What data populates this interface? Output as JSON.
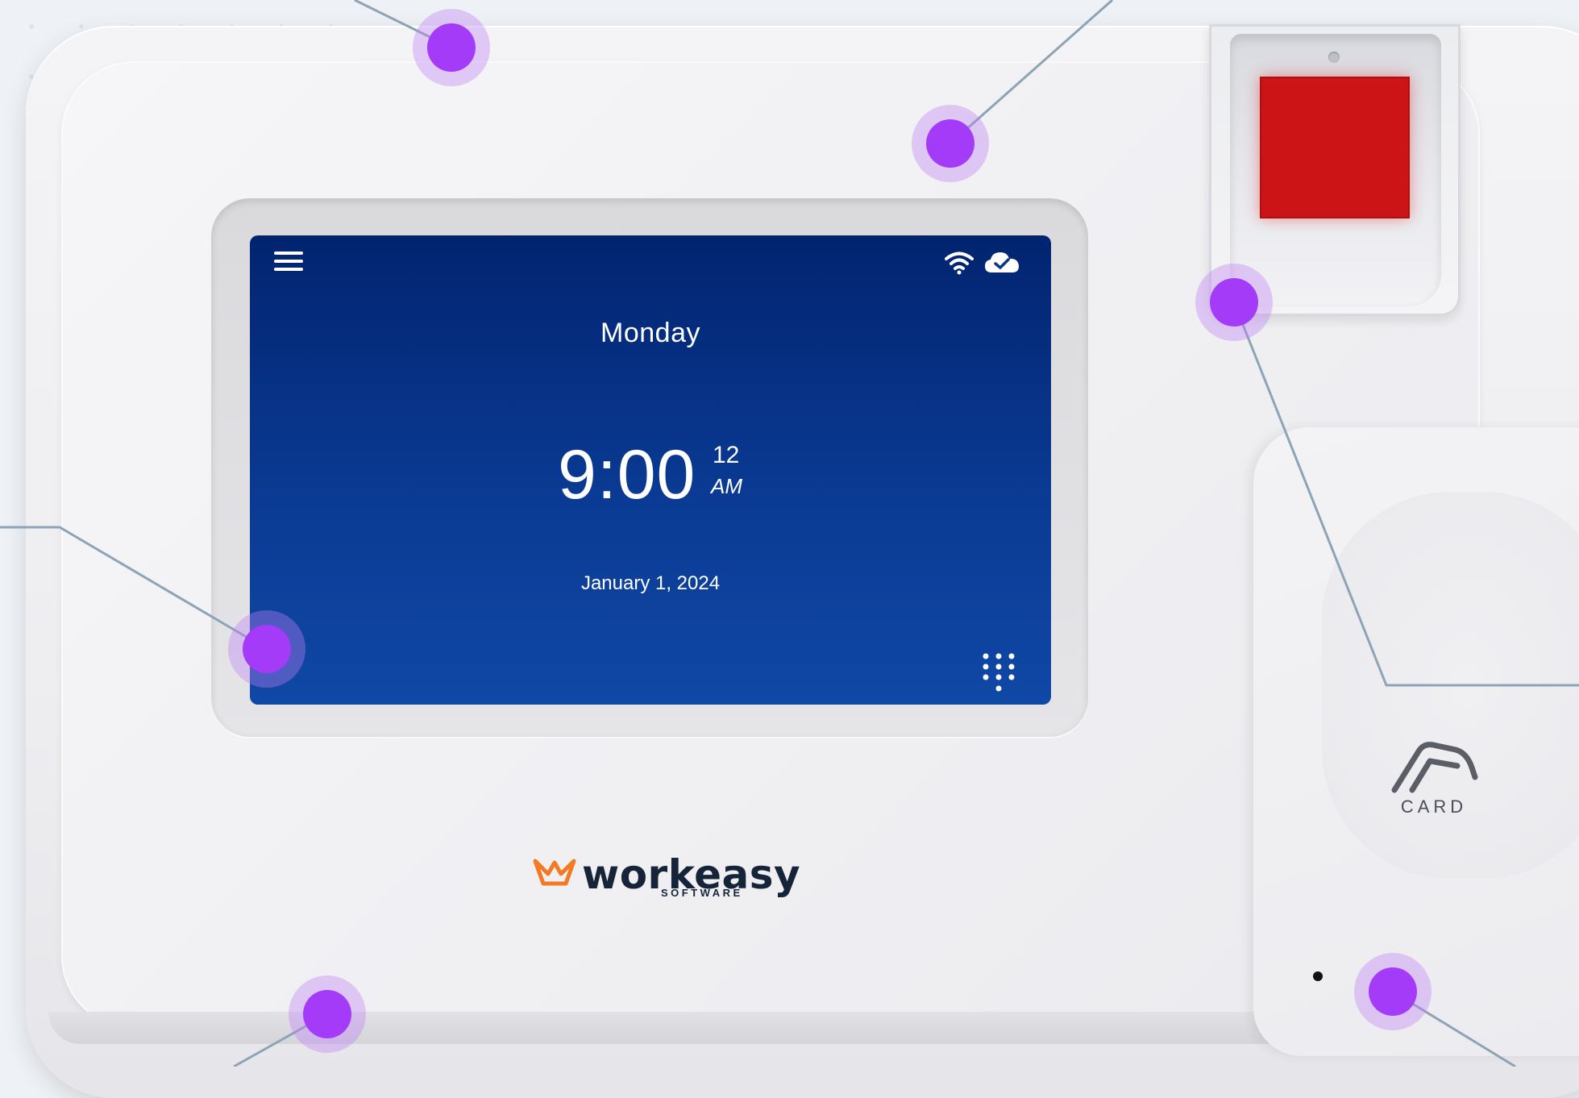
{
  "screen": {
    "day": "Monday",
    "time": {
      "hours_minutes": "9:00",
      "seconds": "12",
      "period": "AM"
    },
    "date": "January 1, 2024",
    "icons": {
      "menu": "hamburger-menu-icon",
      "wifi": "wifi-icon",
      "cloud": "cloud-check-icon",
      "keypad": "keypad-icon"
    },
    "background_colors": [
      "#022470",
      "#1048a6"
    ]
  },
  "logo": {
    "name": "workeasy",
    "tagline": "SOFTWARE",
    "mark_color": "#f37a22"
  },
  "card_reader": {
    "label": "CARD"
  },
  "fingerprint_sensor": {
    "color": "#cc1416"
  },
  "hotspots": {
    "count": 6,
    "color": "#a33bf8"
  }
}
